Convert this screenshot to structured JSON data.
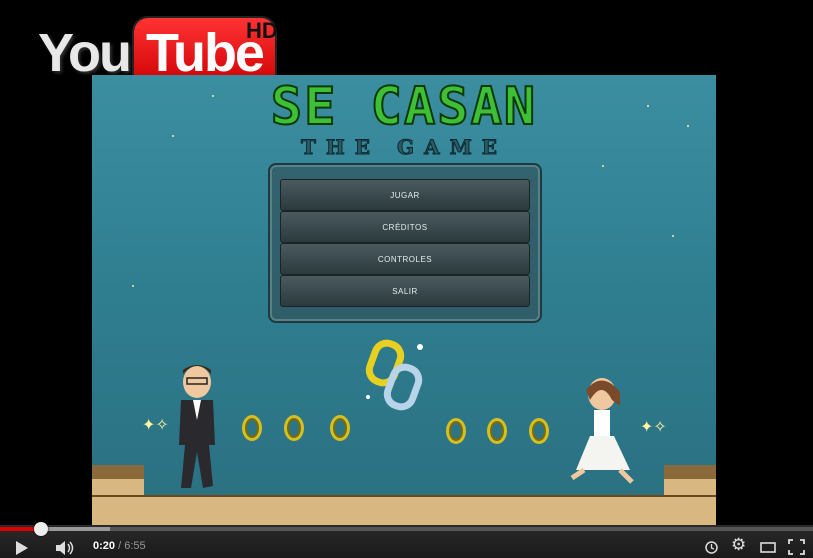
{
  "logo": {
    "you": "You",
    "tube": "Tube",
    "hd": "HD"
  },
  "game": {
    "title": "SE CASAN",
    "subtitle": "THE GAME",
    "menu": [
      "JUGAR",
      "CRÉDITOS",
      "CONTROLES",
      "SALIR"
    ]
  },
  "player": {
    "current_time": "0:20",
    "separator": " / ",
    "duration": "6:55",
    "progress_fraction": 0.05
  },
  "icons": [
    "play-icon",
    "volume-icon",
    "clock-icon",
    "settings-icon",
    "theater-icon",
    "fullscreen-icon"
  ],
  "colors": {
    "progress": "#dd0000",
    "title": "#3fbf35"
  }
}
